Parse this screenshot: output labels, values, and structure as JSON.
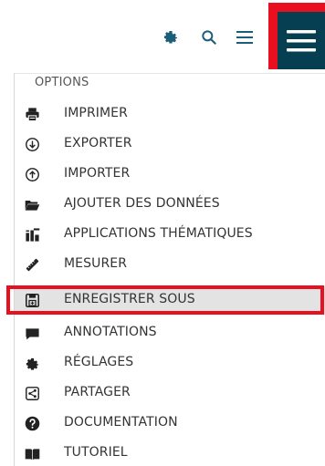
{
  "toolbar": {
    "icons": [
      "gear-icon",
      "search-icon",
      "menu-icon",
      "menu-icon"
    ],
    "menu_button_bg": "#073f52",
    "accent": "#1b5e77",
    "highlight": "#e8101e"
  },
  "menu": {
    "header": "OPTIONS",
    "items": [
      {
        "label": "IMPRIMER",
        "icon": "printer-icon"
      },
      {
        "label": "EXPORTER",
        "icon": "download-circle-icon"
      },
      {
        "label": "IMPORTER",
        "icon": "upload-circle-icon"
      },
      {
        "label": "AJOUTER DES DONNÉES",
        "icon": "folder-open-icon"
      },
      {
        "label": "APPLICATIONS THÉMATIQUES",
        "icon": "thematic-apps-icon"
      },
      {
        "label": "MESURER",
        "icon": "ruler-icon"
      },
      {
        "label": "ENREGISTRER SOUS",
        "icon": "save-icon"
      },
      {
        "label": "ANNOTATIONS",
        "icon": "comment-icon"
      },
      {
        "label": "RÉGLAGES",
        "icon": "gear-icon"
      },
      {
        "label": "PARTAGER",
        "icon": "share-icon"
      },
      {
        "label": "DOCUMENTATION",
        "icon": "question-circle-icon"
      },
      {
        "label": "TUTORIEL",
        "icon": "book-icon"
      }
    ],
    "selected_item": "ENREGISTRER SOUS"
  }
}
